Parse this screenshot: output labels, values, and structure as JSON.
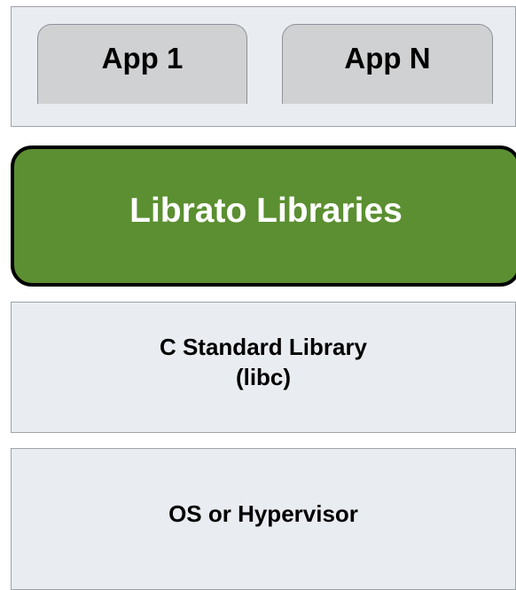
{
  "layers": {
    "apps": {
      "app_1": "App 1",
      "app_n": "App N"
    },
    "librato": {
      "label": "Librato Libraries",
      "fill_color": "#5b8f31"
    },
    "libc": {
      "line1": "C Standard Library",
      "line2": "(libc)"
    },
    "os": {
      "label": "OS or Hypervisor"
    }
  }
}
